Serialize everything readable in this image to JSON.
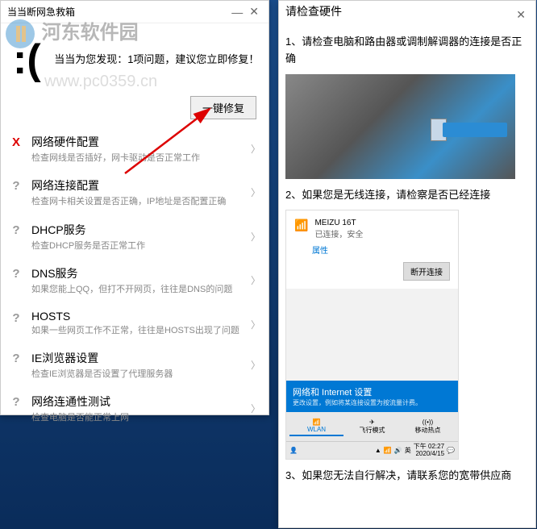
{
  "watermark": {
    "text": "河东软件园",
    "url": "www.pc0359.cn"
  },
  "left": {
    "title": "当当断网急救箱",
    "summary": "当当为您发现：1项问题，建议您立即修复！",
    "fix_button": "一键修复",
    "items": [
      {
        "status": "X",
        "cls": "status-x",
        "title": "网络硬件配置",
        "desc": "检查网线是否插好，网卡驱动是否正常工作"
      },
      {
        "status": "?",
        "cls": "status-q",
        "title": "网络连接配置",
        "desc": "检查网卡相关设置是否正确，IP地址是否配置正确"
      },
      {
        "status": "?",
        "cls": "status-q",
        "title": "DHCP服务",
        "desc": "检查DHCP服务是否正常工作"
      },
      {
        "status": "?",
        "cls": "status-q",
        "title": "DNS服务",
        "desc": "如果您能上QQ，但打不开网页，往往是DNS的问题"
      },
      {
        "status": "?",
        "cls": "status-q",
        "title": "HOSTS",
        "desc": "如果一些网页工作不正常，往往是HOSTS出现了问题"
      },
      {
        "status": "?",
        "cls": "status-q",
        "title": "IE浏览器设置",
        "desc": "检查IE浏览器是否设置了代理服务器"
      },
      {
        "status": "?",
        "cls": "status-q",
        "title": "网络连通性测试",
        "desc": "检查电脑是否能正常上网"
      }
    ]
  },
  "right": {
    "title": "请检查硬件",
    "step1": "1、请检查电脑和路由器或调制解调器的连接是否正确",
    "step2": "2、如果您是无线连接，请检察是否已经连接",
    "step3": "3、如果您无法自行解决，请联系您的宽带供应商",
    "wifi": {
      "name": "MEIZU 16T",
      "status": "已连接，安全",
      "prop": "属性",
      "disconnect": "断开连接",
      "settings_title": "网络和 Internet 设置",
      "settings_sub": "更改设置，例如将某连接设置为按流量计费。",
      "tabs": [
        "WLAN",
        "飞行模式",
        "移动热点"
      ],
      "time": "下午 02:27",
      "date": "2020/4/15"
    }
  }
}
